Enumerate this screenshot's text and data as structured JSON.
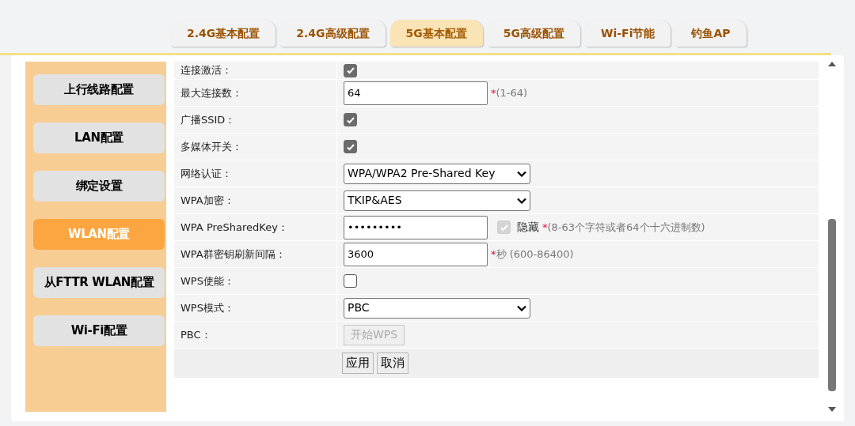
{
  "tabs": [
    {
      "label": "2.4G基本配置",
      "selected": false
    },
    {
      "label": "2.4G高级配置",
      "selected": false
    },
    {
      "label": "5G基本配置",
      "selected": true
    },
    {
      "label": "5G高级配置",
      "selected": false
    },
    {
      "label": "Wi-Fi节能",
      "selected": false
    },
    {
      "label": "钓鱼AP",
      "selected": false
    }
  ],
  "sidebar": {
    "items": [
      {
        "label": "上行线路配置",
        "selected": false
      },
      {
        "label": "LAN配置",
        "selected": false
      },
      {
        "label": "绑定设置",
        "selected": false
      },
      {
        "label": "WLAN配置",
        "selected": true
      },
      {
        "label": "从FTTR WLAN配置",
        "selected": false
      },
      {
        "label": "Wi-Fi配置",
        "selected": false
      }
    ]
  },
  "form": {
    "rows": [
      {
        "kind": "checkbox",
        "label": "连接激活：",
        "checked": true
      },
      {
        "kind": "text",
        "label": "最大连接数：",
        "value": "64",
        "mark": "*",
        "hint": "(1-64)"
      },
      {
        "kind": "checkbox",
        "label": "广播SSID：",
        "checked": true
      },
      {
        "kind": "checkbox",
        "label": "多媒体开关：",
        "checked": true
      },
      {
        "kind": "select",
        "label": "网络认证：",
        "value": "WPA/WPA2 Pre-Shared Key"
      },
      {
        "kind": "select",
        "label": "WPA加密：",
        "value": "TKIP&AES"
      },
      {
        "kind": "password",
        "label": "WPA PreSharedKey：",
        "value": "•••••••••",
        "hide": {
          "label": "隐藏",
          "checked": true,
          "disabled": true
        },
        "mark": "*",
        "hint": "(8-63个字符或者64个十六进制数)"
      },
      {
        "kind": "text",
        "label": "WPA群密钥刷新间隔：",
        "value": "3600",
        "mark": "*",
        "hint": "秒 (600-86400)"
      },
      {
        "kind": "checkbox",
        "label": "WPS使能：",
        "checked": false
      },
      {
        "kind": "select",
        "label": "WPS模式：",
        "value": "PBC"
      },
      {
        "kind": "button",
        "label": "PBC：",
        "button": "开始WPS",
        "disabled": true
      }
    ],
    "actions": [
      "应用",
      "取消"
    ]
  }
}
